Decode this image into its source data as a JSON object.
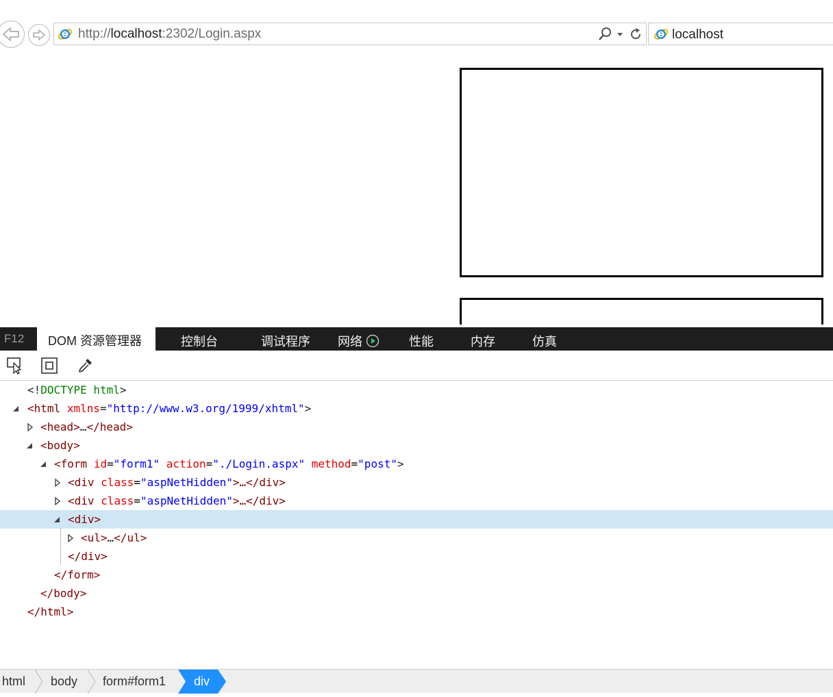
{
  "browser": {
    "address_prefix": "http://",
    "address_host": "localhost",
    "address_rest": ":2302/Login.aspx",
    "tab_title": "localhost"
  },
  "devtools": {
    "f12_label": "F12",
    "tabs": [
      {
        "label": "DOM 资源管理器",
        "active": true
      },
      {
        "label": "控制台"
      },
      {
        "label": "调试程序"
      },
      {
        "label": "网络"
      },
      {
        "label": "性能"
      },
      {
        "label": "内存"
      },
      {
        "label": "仿真"
      }
    ],
    "tree": {
      "doctype": {
        "open": "<!",
        "keyword": "DOCTYPE html",
        "close": ">"
      },
      "html_open": {
        "tag": "<html",
        "attr": "xmlns",
        "eq": "=",
        "value": "\"http://www.w3.org/1999/xhtml\"",
        "close": ">"
      },
      "head": {
        "open": "<head>",
        "ellipsis": "…",
        "close": "</head>"
      },
      "body_open": {
        "tag": "<body>"
      },
      "form_open": {
        "tag": "<form",
        "a1": "id",
        "v1": "\"form1\"",
        "a2": "action",
        "v2": "\"./Login.aspx\"",
        "a3": "method",
        "v3": "\"post\"",
        "close": ">"
      },
      "hidden1": {
        "tag": "<div",
        "attr": "class",
        "value": "\"aspNetHidden\"",
        "rest": ">…</div>"
      },
      "hidden2": {
        "tag": "<div",
        "attr": "class",
        "value": "\"aspNetHidden\"",
        "rest": ">…</div>"
      },
      "div_open": {
        "tag": "<div>"
      },
      "ul": {
        "open": "<ul>",
        "ellipsis": "…",
        "close": "</ul>"
      },
      "div_close": {
        "tag": "</div>"
      },
      "form_close": {
        "tag": "</form>"
      },
      "body_close": {
        "tag": "</body>"
      },
      "html_close": {
        "tag": "</html>"
      }
    },
    "breadcrumbs": [
      "html",
      "body",
      "form#form1",
      "div"
    ]
  },
  "colors": {
    "tag": "#800000",
    "attr_name": "#e50000",
    "attr_value": "#0000ff",
    "doctype": "#008000",
    "selected_row": "#cfe6f4",
    "active_crumb": "#1e90ff",
    "devtools_bar": "#1e1e1e"
  }
}
